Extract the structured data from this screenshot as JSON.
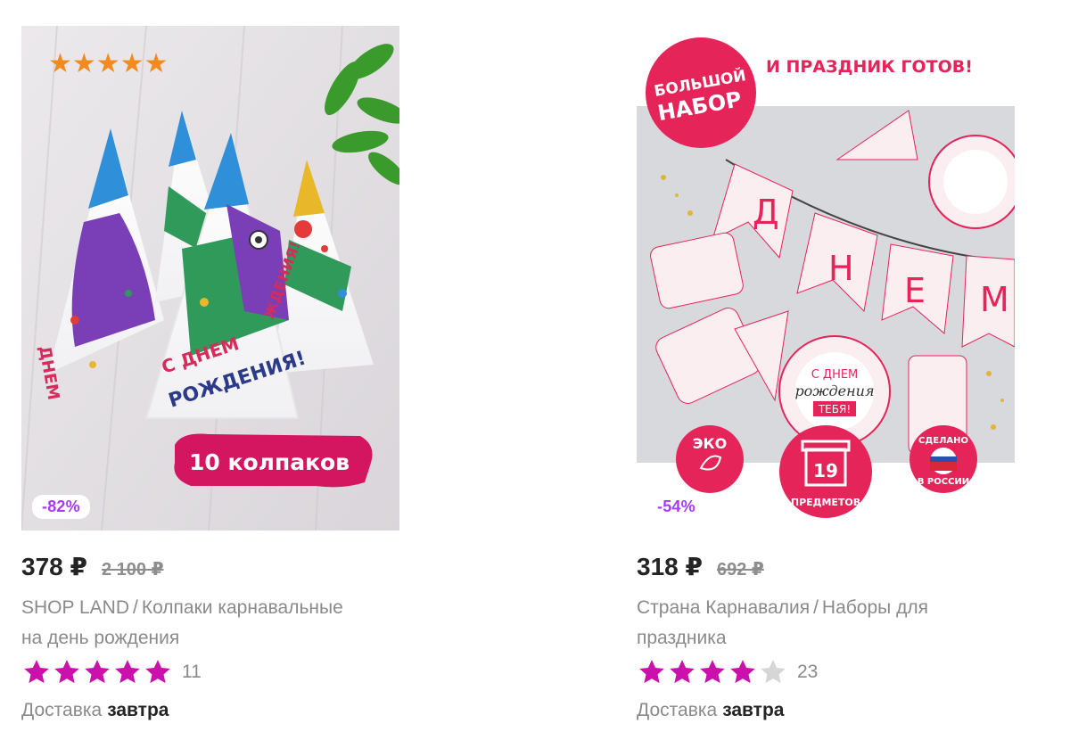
{
  "products": [
    {
      "discount": "-82%",
      "price": "378 ₽",
      "old_price": "2 100 ₽",
      "brand": "SHOP LAND",
      "separator": "/",
      "name_line1": "Колпаки карнавальные",
      "name_line2": "на день рождения",
      "rating_stars": 5,
      "reviews": "11",
      "delivery_label": "Доставка",
      "delivery_when": "завтра",
      "image": {
        "badge_text": "10 колпаков",
        "hat_text_1": "С ДНЕМ",
        "hat_text_2": "РОЖДЕНИЯ!",
        "side_text_1": "ДНЕМ",
        "side_text_2": "ЖДЕНИЯ!"
      }
    },
    {
      "discount": "-54%",
      "price": "318 ₽",
      "old_price": "692 ₽",
      "brand": "Страна Карнавалия",
      "separator": "/",
      "name_line1": "Наборы для",
      "name_line2": "праздника",
      "rating_stars": 4,
      "reviews": "23",
      "delivery_label": "Доставка",
      "delivery_when": "завтра",
      "image": {
        "circle_line1": "БОЛЬШОЙ",
        "circle_line2": "НАБОР",
        "headline": "И ПРАЗДНИК ГОТОВ!",
        "plate_line1": "С ДНЕМ",
        "plate_line2": "рождения",
        "plate_line3": "ТЕБЯ!",
        "eco": "ЭКО",
        "gift_number": "19",
        "gift_label": "ПРЕДМЕТОВ",
        "made_line1": "СДЕЛАНО",
        "made_line2": "В РОССИИ",
        "banner_letters": [
          "Д",
          "Н",
          "Е",
          "М"
        ]
      }
    }
  ],
  "colors": {
    "discount_text": "#a73afd",
    "star_filled": "#cb11ab",
    "star_empty": "#d6d6d6",
    "price_text": "#242424",
    "muted_text": "#8a8a8a"
  }
}
